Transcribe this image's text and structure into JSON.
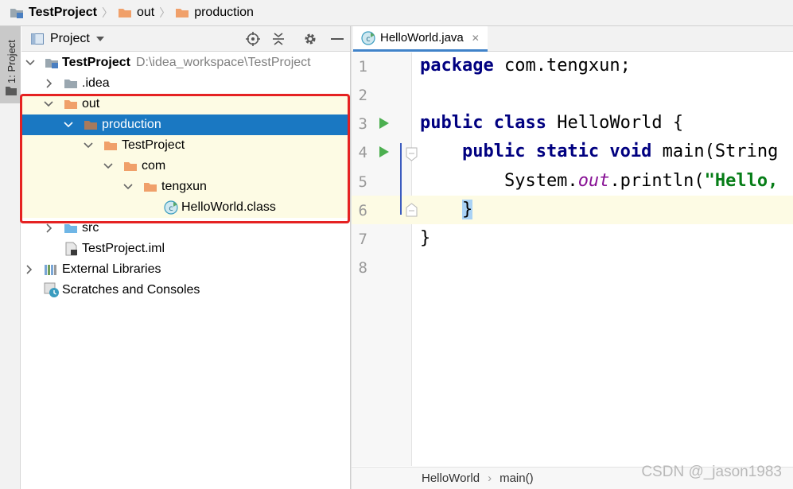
{
  "navbar": {
    "items": [
      {
        "label": "TestProject",
        "icon": "module-folder-icon"
      },
      {
        "label": "out",
        "icon": "folder-orange-icon"
      },
      {
        "label": "production",
        "icon": "folder-orange-icon"
      }
    ]
  },
  "left_stripe": {
    "project_label": "1: Project"
  },
  "project_panel": {
    "title": "Project",
    "tools": [
      "locate-icon",
      "collapse-all-icon",
      "settings-icon",
      "hide-icon"
    ]
  },
  "tree": {
    "root_label": "TestProject",
    "root_path": "D:\\idea_workspace\\TestProject",
    "idea": ".idea",
    "out": "out",
    "production": "production",
    "testproject_sub": "TestProject",
    "com": "com",
    "tengxun": "tengxun",
    "helloworld_class": "HelloWorld.class",
    "src": "src",
    "iml": "TestProject.iml",
    "external_libs": "External Libraries",
    "scratches": "Scratches and Consoles"
  },
  "editor": {
    "tab_label": "HelloWorld.java",
    "line_numbers": [
      "1",
      "2",
      "3",
      "4",
      "5",
      "6",
      "7",
      "8"
    ],
    "breadcrumbs": [
      "HelloWorld",
      "main()"
    ]
  },
  "watermark": "CSDN @_jason1983",
  "colors": {
    "selection": "#1a78c2",
    "highlight_box": "#e52222",
    "folder_orange": "#f0a06a",
    "keyword": "#000080",
    "string": "#067d17"
  }
}
